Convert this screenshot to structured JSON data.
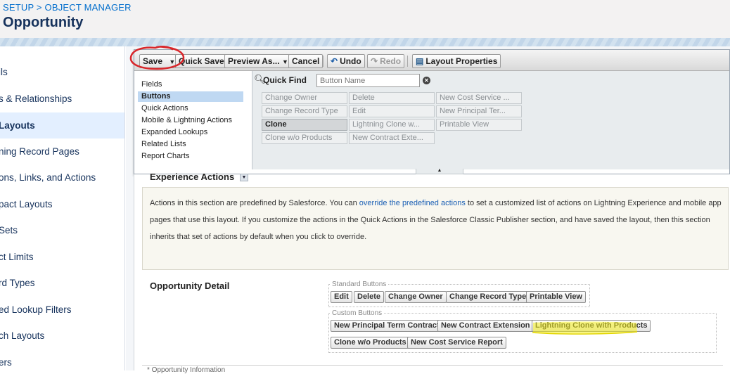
{
  "header": {
    "breadcrumb": [
      "SETUP",
      "OBJECT MANAGER"
    ],
    "breadcrumb_sep": ">",
    "title": "Opportunity"
  },
  "sidebar": {
    "items": [
      {
        "label": "ils",
        "active": false
      },
      {
        "label": "s & Relationships",
        "active": false
      },
      {
        "label": " Layouts",
        "active": true
      },
      {
        "label": "ning Record Pages",
        "active": false
      },
      {
        "label": "ons, Links, and Actions",
        "active": false
      },
      {
        "label": "pact Layouts",
        "active": false
      },
      {
        "label": " Sets",
        "active": false
      },
      {
        "label": "ct Limits",
        "active": false
      },
      {
        "label": "rd Types",
        "active": false
      },
      {
        "label": "ed Lookup Filters",
        "active": false
      },
      {
        "label": "ch Layouts",
        "active": false
      },
      {
        "label": "ers",
        "active": false
      }
    ]
  },
  "toolbar": {
    "save": "Save",
    "save_dropdown": "▼",
    "quick_save": "Quick Save",
    "preview_as": "Preview As...",
    "preview_dropdown": "▼",
    "cancel": "Cancel",
    "undo": "Undo",
    "redo": "Redo",
    "layout_properties": "Layout Properties"
  },
  "palette": {
    "categories": [
      {
        "label": "Fields",
        "selected": false
      },
      {
        "label": "Buttons",
        "selected": true
      },
      {
        "label": "Quick Actions",
        "selected": false
      },
      {
        "label": "Mobile & Lightning Actions",
        "selected": false
      },
      {
        "label": "Expanded Lookups",
        "selected": false
      },
      {
        "label": "Related Lists",
        "selected": false
      },
      {
        "label": "Report Charts",
        "selected": false
      }
    ],
    "quick_find_label": "Quick Find",
    "quick_find_placeholder": "Button Name",
    "items": [
      [
        "Change Owner",
        "Delete",
        "New Cost Service ..."
      ],
      [
        "Change Record Type",
        "Edit",
        "New Principal Ter..."
      ],
      [
        "Clone",
        "Lightning Clone w...",
        "Printable View"
      ],
      [
        "Clone w/o Products",
        "New Contract Exte...",
        ""
      ]
    ],
    "selected_item": "Clone"
  },
  "experience": {
    "title": "Experience Actions",
    "text_before_link": "Actions in this section are predefined by Salesforce. You can ",
    "link": "override the predefined actions",
    "text_after_link": " to set a customized list of actions on Lightning Experience and mobile app pages that use this layout. If you customize the actions in the Quick Actions in the Salesforce Classic Publisher section, and have saved the layout, then this section inherits that set of actions by default when you click to override."
  },
  "detail": {
    "title": "Opportunity Detail",
    "standard_label": "Standard Buttons",
    "standard_buttons": [
      "Edit",
      "Delete",
      "Change Owner",
      "Change Record Type",
      "Printable View"
    ],
    "custom_label": "Custom Buttons",
    "custom_buttons_row1": [
      "New Principal Term Contract",
      "New Contract Extension",
      "Lightning Clone with Products"
    ],
    "custom_buttons_row2": [
      "Clone w/o Products",
      "New Cost Service Report"
    ]
  },
  "footer_partial": "* Opportunity Information",
  "colors": {
    "annotation_circle": "#d9262a",
    "annotation_highlight": "#f4ee1d",
    "selected_sidebar": "#e3efff",
    "link": "#006dcc"
  }
}
